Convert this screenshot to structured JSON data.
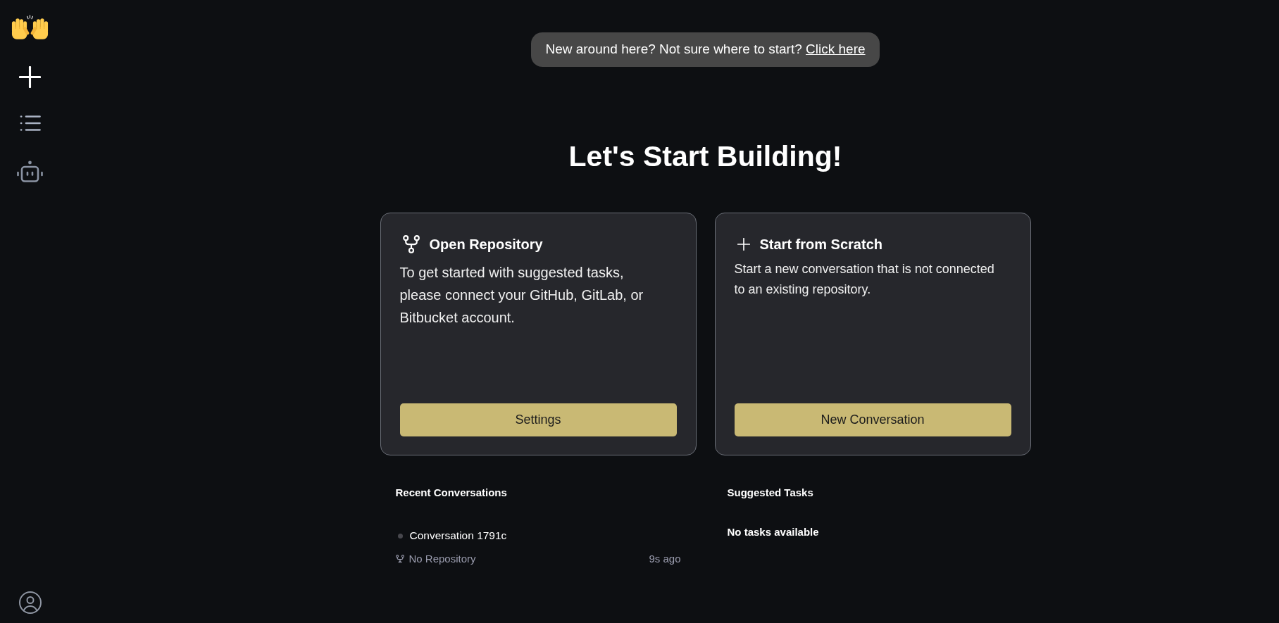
{
  "banner": {
    "text": "New around here? Not sure where to start?",
    "link": "Click here"
  },
  "heading": "Let's Start Building!",
  "cards": [
    {
      "kind": "repository",
      "title": "Open Repository",
      "description": "To get started with suggested tasks, please connect your GitHub, GitLab, or Bitbucket account.",
      "button": "Settings"
    },
    {
      "kind": "scratch",
      "title": "Start from Scratch",
      "description": "Start a new conversation that is not connected to an existing repository.",
      "button": "New Conversation"
    }
  ],
  "recent_conversations": {
    "title": "Recent Conversations",
    "items": [
      {
        "title": "Conversation 1791c",
        "repository": "No Repository",
        "time": "9s ago"
      }
    ]
  },
  "suggested_tasks": {
    "title": "Suggested Tasks",
    "empty_message": "No tasks available"
  }
}
